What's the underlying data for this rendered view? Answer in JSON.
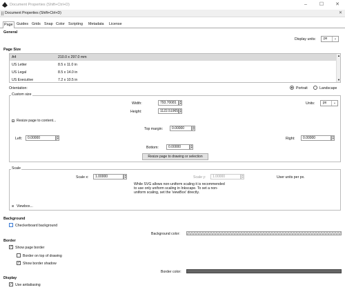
{
  "window": {
    "title": "Document Properties (Shift+Ctrl+D)",
    "subtitle": "Document Properties (Shift+Ctrl+D)",
    "minimize": "–",
    "maximize": "☐",
    "close": "✕"
  },
  "tabs": [
    "Page",
    "Guides",
    "Grids",
    "Snap",
    "Color",
    "Scripting",
    "Metadata",
    "License"
  ],
  "general": {
    "heading": "General",
    "display_units_label": "Display units:",
    "display_units_value": "px"
  },
  "page_size": {
    "heading": "Page Size",
    "rows": [
      {
        "name": "A4",
        "size": "210.0 x 297.0 mm"
      },
      {
        "name": "US Letter",
        "size": "8.5 x 11.0 in"
      },
      {
        "name": "US Legal",
        "size": "8.5 x 14.0 in"
      },
      {
        "name": "US Executive",
        "size": "7.2 x 10.5 in"
      }
    ],
    "orientation_label": "Orientation:",
    "portrait": "Portrait",
    "landscape": "Landscape"
  },
  "custom_size": {
    "title": "Custom size",
    "width_label": "Width:",
    "width_value": "793.70081",
    "height_label": "Height:",
    "height_value": "1122.51965",
    "units_label": "Units:",
    "units_value": "px",
    "resize_toggle": "Resize page to content...",
    "top_label": "Top margin:",
    "top_value": "0.00000",
    "left_label": "Left:",
    "left_value": "0.00000",
    "right_label": "Right:",
    "right_value": "0.00000",
    "bottom_label": "Bottom:",
    "bottom_value": "0.00000",
    "resize_button": "Resize page to drawing or selection"
  },
  "scale": {
    "title": "Scale",
    "scale_x_label": "Scale x:",
    "scale_x_value": "1.00000",
    "scale_y_label": "Scale y:",
    "scale_y_value": "1.00000",
    "user_units": "User units per px.",
    "note": "While SVG allows non-uniform scaling it is recommended to use only uniform scaling in Inkscape. To set a non-uniform scaling, set the 'viewBox' directly.",
    "viewbox": "Viewbox..."
  },
  "background": {
    "heading": "Background",
    "checkerboard": "Checkerboard background",
    "color_label": "Background color:"
  },
  "border": {
    "heading": "Border",
    "show_page_border": "Show page border",
    "border_on_top": "Border on top of drawing",
    "show_border_shadow": "Show border shadow",
    "color_label": "Border color:"
  },
  "display": {
    "heading": "Display",
    "antialiasing": "Use antialiasing"
  },
  "colors": {
    "border_color": "#666666",
    "checkbox_accent": "#3a7bd5"
  }
}
